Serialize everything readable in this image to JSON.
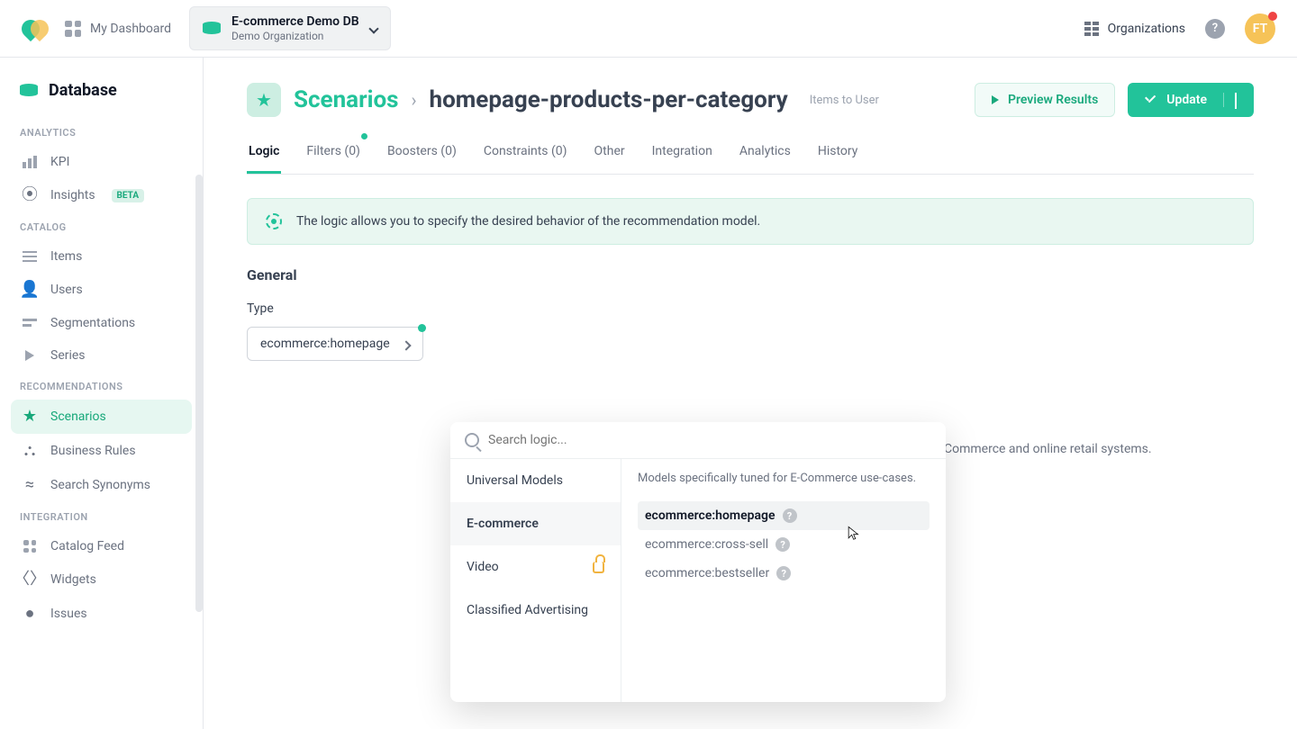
{
  "header": {
    "dashboard_label": "My Dashboard",
    "db_name": "E-commerce Demo DB",
    "db_org": "Demo Organization",
    "organizations_label": "Organizations",
    "avatar_initials": "FT"
  },
  "sidebar": {
    "database_label": "Database",
    "groups": {
      "analytics": {
        "header": "ANALYTICS",
        "kpi": "KPI",
        "insights": "Insights",
        "insights_badge": "BETA"
      },
      "catalog": {
        "header": "CATALOG",
        "items": "Items",
        "users": "Users",
        "segmentations": "Segmentations",
        "series": "Series"
      },
      "recommendations": {
        "header": "RECOMMENDATIONS",
        "scenarios": "Scenarios",
        "business_rules": "Business Rules",
        "search_synonyms": "Search Synonyms"
      },
      "integration": {
        "header": "INTEGRATION",
        "catalog_feed": "Catalog Feed",
        "widgets": "Widgets",
        "issues": "Issues"
      }
    }
  },
  "page": {
    "breadcrumb_root": "Scenarios",
    "title": "homepage-products-per-category",
    "meta": "Items to User",
    "preview_label": "Preview Results",
    "update_label": "Update"
  },
  "tabs": {
    "logic": "Logic",
    "filters": "Filters (0)",
    "boosters": "Boosters (0)",
    "constraints": "Constraints (0)",
    "other": "Other",
    "integration": "Integration",
    "analytics": "Analytics",
    "history": "History"
  },
  "banner": {
    "text": "The logic allows you to specify the desired behavior of the recommendation model."
  },
  "general": {
    "heading": "General",
    "type_label": "Type",
    "type_value": "ecommerce:homepage",
    "trailing_desc": "Commerce and online retail systems."
  },
  "dropdown": {
    "search_placeholder": "Search logic...",
    "categories": {
      "universal": "Universal Models",
      "ecommerce": "E-commerce",
      "video": "Video",
      "classified": "Classified Advertising"
    },
    "panel_desc": "Models specifically tuned for E-Commerce use-cases.",
    "options": {
      "homepage": "ecommerce:homepage",
      "cross": "ecommerce:cross-sell",
      "best": "ecommerce:bestseller"
    }
  }
}
